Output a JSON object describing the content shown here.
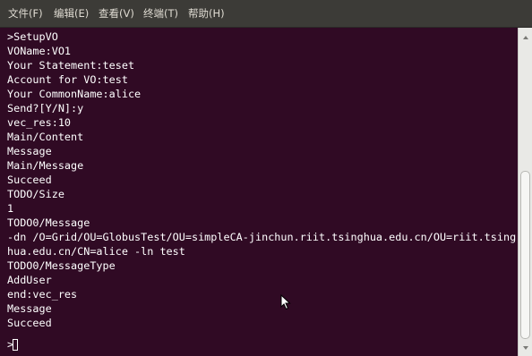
{
  "menubar": {
    "items": [
      "文件(F)",
      "编辑(E)",
      "查看(V)",
      "终端(T)",
      "帮助(H)"
    ]
  },
  "terminal": {
    "lines": [
      ">SetupVO",
      "VOName:VO1",
      "Your Statement:teset",
      "Account for VO:test",
      "Your CommonName:alice",
      "Send?[Y/N]:y",
      "vec_res:10",
      "Main/Content",
      "Message",
      "Main/Message",
      "Succeed",
      "TODO/Size",
      "1",
      "TODO0/Message",
      "-dn /O=Grid/OU=GlobusTest/OU=simpleCA-jinchun.riit.tsinghua.edu.cn/OU=riit.tsing",
      "hua.edu.cn/CN=alice -ln test",
      "TODO0/MessageType",
      "AddUser",
      "end:vec_res",
      "Message",
      "Succeed"
    ],
    "prompt": ">"
  },
  "icons": {
    "mouse": "mouse-pointer-icon",
    "scroll_up": "scroll-up-arrow-icon",
    "scroll_down": "scroll-down-arrow-icon"
  },
  "colors": {
    "terminal_bg": "#300a24",
    "terminal_text": "#ffffff",
    "menubar_bg": "#3c3b37",
    "menubar_text": "#dfdbd2"
  }
}
